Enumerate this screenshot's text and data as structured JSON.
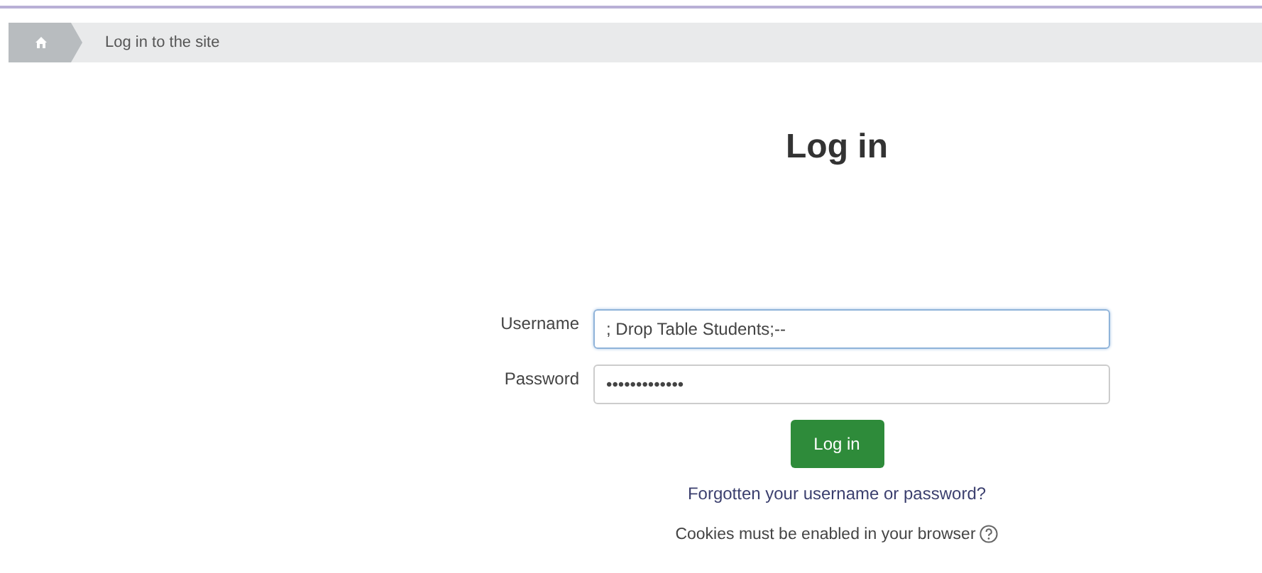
{
  "breadcrumb": {
    "items": [
      {
        "label": "Log in to the site"
      }
    ]
  },
  "title": "Log in",
  "fields": [
    {
      "label": "Username",
      "value": "; Drop Table Students;--",
      "focused": true
    },
    {
      "label": "Password",
      "value": "•••••••••••••",
      "focused": false
    }
  ],
  "submit": "Log in",
  "forgot_link": "Forgotten your username or password?",
  "cookies_note": "Cookies must be enabled in your browser"
}
